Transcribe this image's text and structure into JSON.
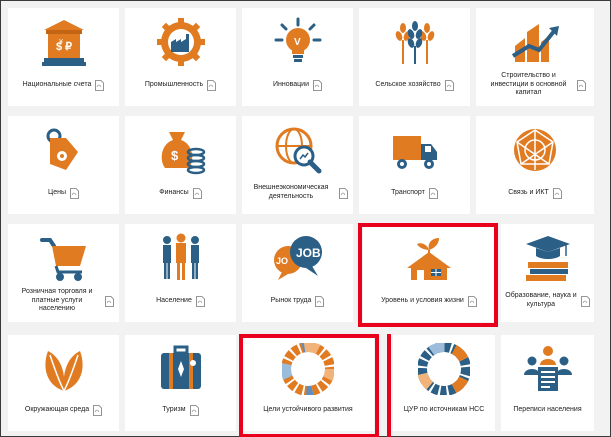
{
  "colors": {
    "orange": "#e07b22",
    "blue": "#2b5f86",
    "highlight": "#e8001c"
  },
  "tiles": [
    {
      "label": "Национальные счета",
      "icon": "bank-icon"
    },
    {
      "label": "Промышленность",
      "icon": "factory-gear-icon"
    },
    {
      "label": "Инновации",
      "icon": "lightbulb-icon"
    },
    {
      "label": "Сельское хозяйство",
      "icon": "wheat-icon"
    },
    {
      "label": "Строительство и инвестиции в основной капитал",
      "icon": "construction-growth-icon"
    },
    {
      "label": "Цены",
      "icon": "price-tag-icon"
    },
    {
      "label": "Финансы",
      "icon": "money-bag-icon"
    },
    {
      "label": "Внешнеэкономическая деятельность",
      "icon": "globe-magnifier-icon"
    },
    {
      "label": "Транспорт",
      "icon": "truck-icon"
    },
    {
      "label": "Связь и ИКТ",
      "icon": "network-globe-icon"
    },
    {
      "label": "Розничная торговля и платные услуги населению",
      "icon": "shopping-cart-icon"
    },
    {
      "label": "Население",
      "icon": "population-icon"
    },
    {
      "label": "Рынок труда",
      "icon": "job-bubbles-icon"
    },
    {
      "label": "Уровень и условия жизни",
      "icon": "house-sprout-icon"
    },
    {
      "label": "Образование, наука и культура",
      "icon": "books-graduation-icon"
    },
    {
      "label": "Окружающая среда",
      "icon": "leaf-icon"
    },
    {
      "label": "Туризм",
      "icon": "suitcase-icon"
    },
    {
      "label": "Цели устойчивого развития",
      "icon": "sdg-wheel-icon"
    },
    {
      "label": "ЦУР по источникам НСС",
      "icon": "sdg-wheel-icon"
    },
    {
      "label": "Переписи населения",
      "icon": "census-people-icon"
    }
  ]
}
